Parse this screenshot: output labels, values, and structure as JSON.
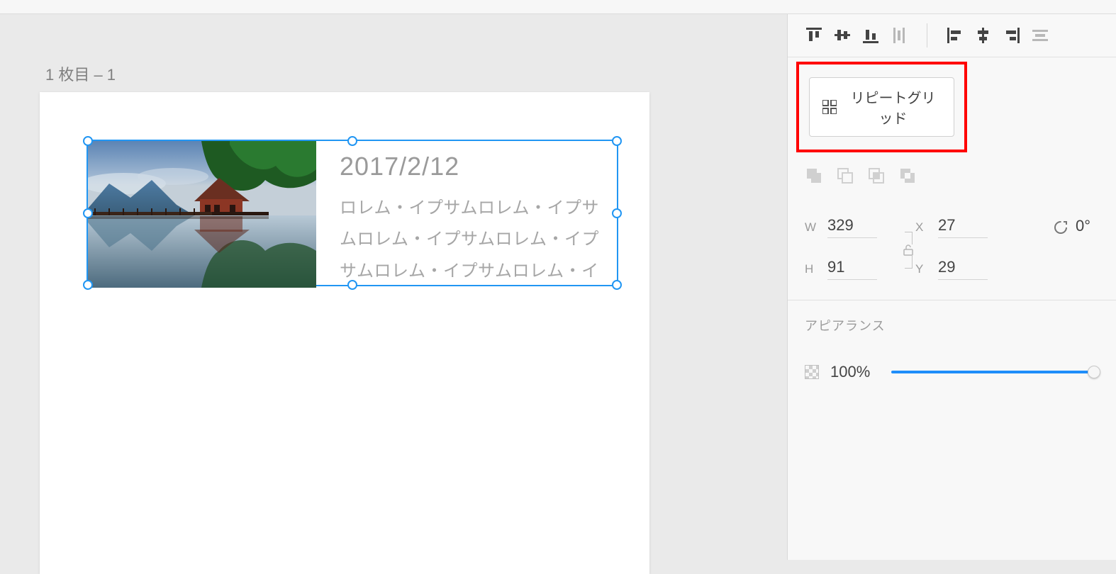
{
  "artboard": {
    "label": "1 枚目 – 1"
  },
  "card": {
    "title": "2017/2/12",
    "body": "ロレム・イプサムロレム・イプサムロレム・イプサムロレム・イプサムロレム・イプサムロレム・イ"
  },
  "panel": {
    "repeatGridLabel": "リピートグリッド",
    "transform": {
      "wLabel": "W",
      "w": "329",
      "hLabel": "H",
      "h": "91",
      "xLabel": "X",
      "x": "27",
      "yLabel": "Y",
      "y": "29",
      "rotation": "0°"
    },
    "appearance": {
      "title": "アピアランス",
      "opacity": "100%"
    }
  }
}
